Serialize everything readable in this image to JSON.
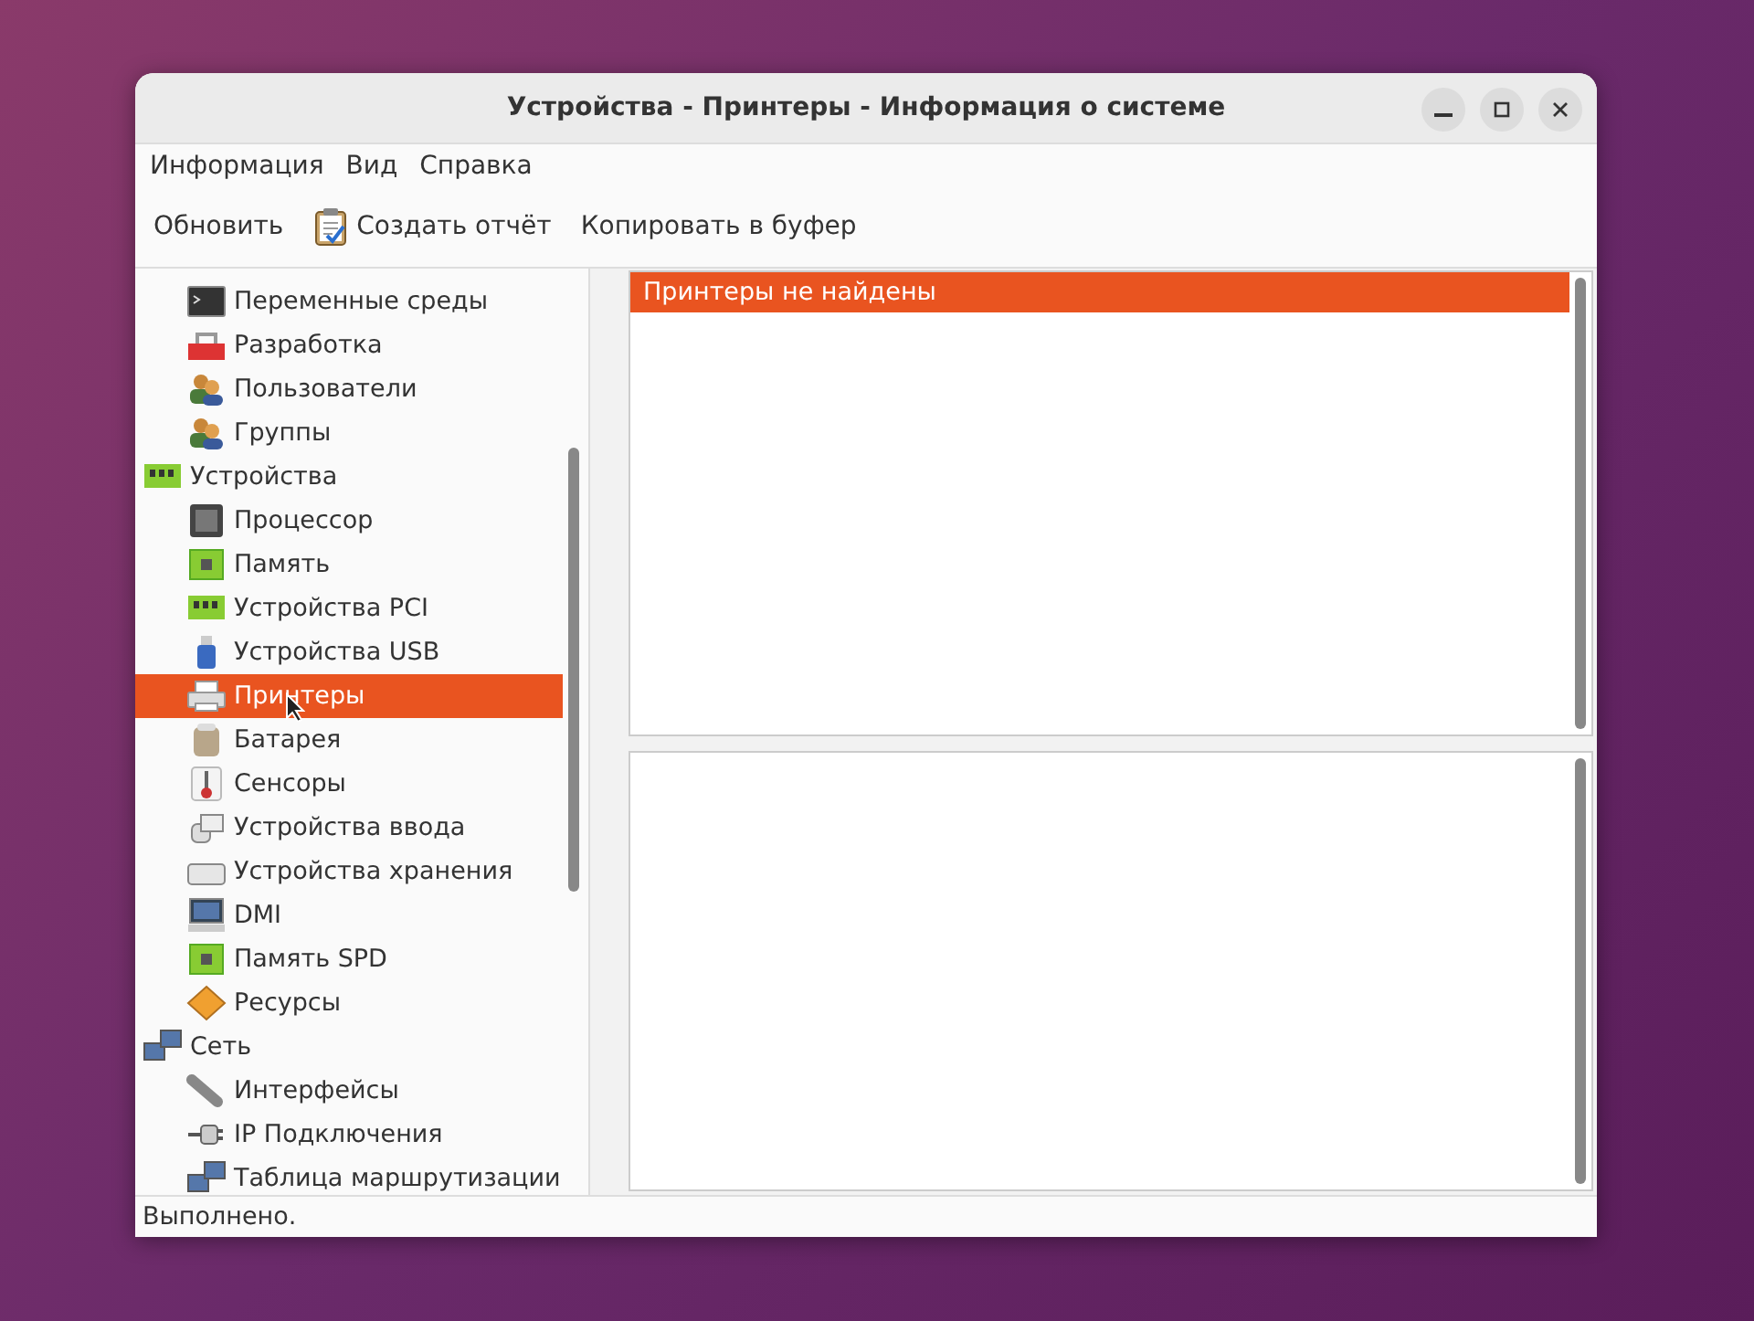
{
  "window": {
    "title": "Устройства - Принтеры - Информация о системе"
  },
  "menu": [
    "Информация",
    "Вид",
    "Справка"
  ],
  "toolbar": [
    {
      "label": "Обновить",
      "kind": "plain"
    },
    {
      "label": "Создать отчёт",
      "kind": "report"
    },
    {
      "label": "Копировать в буфер",
      "kind": "plain"
    }
  ],
  "tree": [
    {
      "children": [
        {
          "label": "Переменные среды",
          "kind": "terminal",
          "selected": false
        },
        {
          "label": "Разработка",
          "kind": "devel",
          "selected": false
        },
        {
          "label": "Пользователи",
          "kind": "users",
          "selected": false
        },
        {
          "label": "Группы",
          "kind": "users",
          "selected": false
        }
      ]
    },
    {
      "label": "Устройства",
      "kind": "board",
      "selected": false,
      "children": [
        {
          "label": "Процессор",
          "kind": "cpu",
          "selected": false
        },
        {
          "label": "Память",
          "kind": "memory",
          "selected": false
        },
        {
          "label": "Устройства PCI",
          "kind": "board",
          "selected": false
        },
        {
          "label": "Устройства USB",
          "kind": "usb",
          "selected": false
        },
        {
          "label": "Принтеры",
          "kind": "printer",
          "selected": true
        },
        {
          "label": "Батарея",
          "kind": "battery",
          "selected": false
        },
        {
          "label": "Сенсоры",
          "kind": "sensor",
          "selected": false
        },
        {
          "label": "Устройства ввода",
          "kind": "input",
          "selected": false
        },
        {
          "label": "Устройства хранения",
          "kind": "storage",
          "selected": false
        },
        {
          "label": "DMI",
          "kind": "monitor",
          "selected": false
        },
        {
          "label": "Память SPD",
          "kind": "memory",
          "selected": false
        },
        {
          "label": "Ресурсы",
          "kind": "resources",
          "selected": false
        }
      ]
    },
    {
      "label": "Сеть",
      "kind": "network",
      "selected": false,
      "children": [
        {
          "label": "Интерфейсы",
          "kind": "interface",
          "selected": false
        },
        {
          "label": "IP Подключения",
          "kind": "plug",
          "selected": false
        },
        {
          "label": "Таблица маршрутизации",
          "kind": "network",
          "selected": false
        }
      ]
    }
  ],
  "results": [
    {
      "text": "Принтеры не найдены",
      "selected": true
    }
  ],
  "status_bar": "Выполнено."
}
